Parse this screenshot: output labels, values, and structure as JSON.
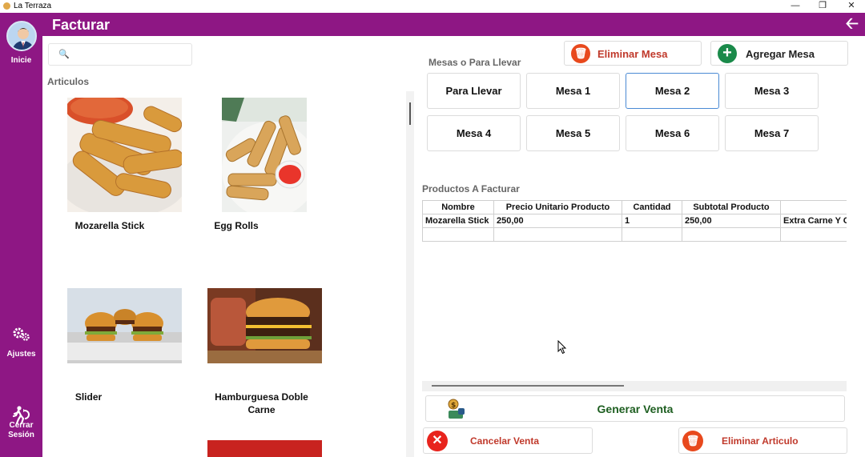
{
  "window": {
    "title": "La Terraza",
    "controls": [
      "—",
      "❐",
      "✕"
    ]
  },
  "header": {
    "title": "Facturar",
    "back_icon": "arrow-left-icon"
  },
  "sidebar": {
    "home_label": "Inicie",
    "settings_label": "Ajustes",
    "logout_label": "Cerrar Sesión"
  },
  "search": {
    "value": "",
    "placeholder": ""
  },
  "articles": {
    "label": "Articulos",
    "items": [
      {
        "name": "Mozarella Stick"
      },
      {
        "name": "Egg Rolls"
      },
      {
        "name": "Slider"
      },
      {
        "name": "Hamburguesa Doble Carne"
      }
    ]
  },
  "tables": {
    "label": "Mesas o Para Llevar",
    "delete_label": "Eliminar Mesa",
    "add_label": "Agregar Mesa",
    "options": [
      "Para Llevar",
      "Mesa 1",
      "Mesa 2",
      "Mesa 3",
      "Mesa 4",
      "Mesa 5",
      "Mesa 6",
      "Mesa 7"
    ],
    "selected": "Mesa 2"
  },
  "invoice": {
    "label": "Productos A Facturar",
    "columns": [
      "Nombre",
      "Precio Unitario Producto",
      "Cantidad",
      "Subtotal Producto",
      ""
    ],
    "rows": [
      [
        "Mozarella Stick",
        "250,00",
        "1",
        "250,00",
        "Extra Carne Y C"
      ]
    ]
  },
  "actions": {
    "generate_label": "Generar Venta",
    "cancel_label": "Cancelar Venta",
    "delete_item_label": "Eliminar Articulo"
  },
  "colors": {
    "brand": "#8e1784",
    "danger": "#e8491d",
    "success": "#1a8a4a",
    "generate_text": "#1d5e20",
    "danger_text": "#c0392b"
  }
}
